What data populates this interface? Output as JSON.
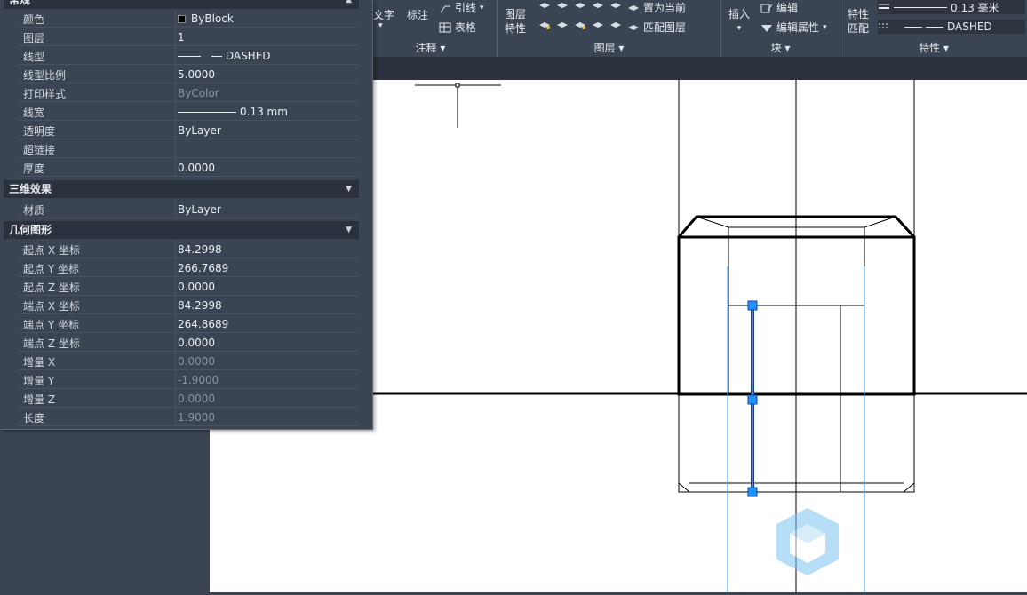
{
  "ribbon": {
    "annotate": {
      "text_label": "文字",
      "dim_label": "标注",
      "leader_label": "引线",
      "table_label": "表格",
      "group_label": "注释"
    },
    "layers": {
      "layer_props_label_1": "图层",
      "layer_props_label_2": "特性",
      "set_current_label": "置为当前",
      "match_layer_label": "匹配图层",
      "group_label": "图层"
    },
    "block": {
      "insert_label": "插入",
      "edit_label": "编辑",
      "edit_attr_label": "编辑属性",
      "group_label": "块"
    },
    "properties": {
      "match_label_1": "特性",
      "match_label_2": "匹配",
      "lineweight_value": "0.13 毫米",
      "linetype_value": "DASHED",
      "group_label": "特性"
    }
  },
  "panel": {
    "section_general": "常规",
    "general_rows": [
      {
        "key": "颜色",
        "value": "ByBlock"
      },
      {
        "key": "图层",
        "value": "1"
      },
      {
        "key": "线型",
        "value": "DASHED"
      },
      {
        "key": "线型比例",
        "value": "5.0000"
      },
      {
        "key": "打印样式",
        "value": "ByColor"
      },
      {
        "key": "线宽",
        "value": "0.13 mm"
      },
      {
        "key": "透明度",
        "value": "ByLayer"
      },
      {
        "key": "超链接",
        "value": ""
      },
      {
        "key": "厚度",
        "value": "0.0000"
      }
    ],
    "section_3d": "三维效果",
    "rows_3d": [
      {
        "key": "材质",
        "value": "ByLayer"
      }
    ],
    "section_geometry": "几何图形",
    "geometry_rows": [
      {
        "key": "起点 X 坐标",
        "value": "84.2998"
      },
      {
        "key": "起点 Y 坐标",
        "value": "266.7689"
      },
      {
        "key": "起点 Z 坐标",
        "value": "0.0000"
      },
      {
        "key": "端点 X 坐标",
        "value": "84.2998"
      },
      {
        "key": "端点 Y 坐标",
        "value": "264.8689"
      },
      {
        "key": "端点 Z 坐标",
        "value": "0.0000"
      },
      {
        "key": "增量 X",
        "value": "0.0000"
      },
      {
        "key": "增量 Y",
        "value": "-1.9000"
      },
      {
        "key": "增量 Z",
        "value": "0.0000"
      },
      {
        "key": "长度",
        "value": "1.9000"
      }
    ]
  },
  "colors": {
    "accent": "#1e90ff",
    "panel_bg": "#3b4453",
    "header_bg": "#2b323d"
  },
  "icons": [
    "color-swatch-icon",
    "layer-icon",
    "block-edit-icon",
    "collapse-arrow-icon",
    "lineweight-icon",
    "linetype-icon",
    "watermark-cube-icon"
  ]
}
